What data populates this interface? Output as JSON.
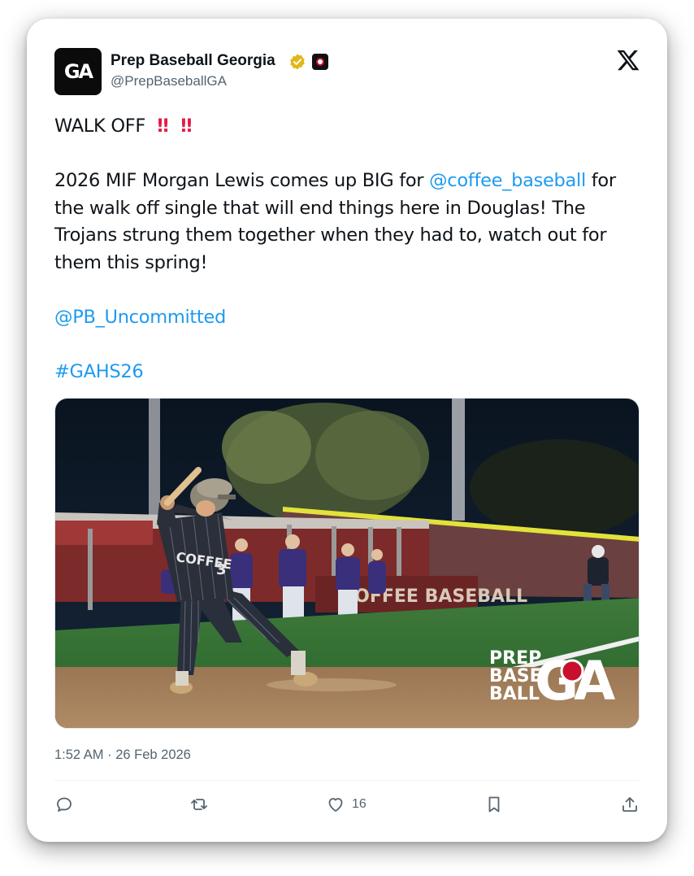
{
  "author": {
    "name": "Prep Baseball Georgia",
    "handle": "@PrepBaseballGA",
    "avatar_text": "GA"
  },
  "post": {
    "headline": "WALK OFF",
    "body_part1": "2026 MIF Morgan Lewis comes up BIG for ",
    "mention_coffee": "@coffee_baseball",
    "body_part2": " for the walk off single that will end things here in Douglas! The Trojans strung them together when they had to, watch out for them this spring!",
    "mention_uncommitted": "@PB_Uncommitted",
    "hashtag": "#GAHS26",
    "timestamp": "1:52 AM · 26 Feb 2026"
  },
  "media": {
    "banner_text": "COFFEE BASEBALL",
    "jersey_text": "COFFEE",
    "jersey_number": "3",
    "watermark_line1": "PREP",
    "watermark_line2": "BASE",
    "watermark_line3": "BALL",
    "watermark_ga": "GA"
  },
  "actions": {
    "likes": "16"
  },
  "colors": {
    "link": "#1d9bf0",
    "text": "#0f1419",
    "muted": "#536471",
    "alert": "#e11d48"
  }
}
